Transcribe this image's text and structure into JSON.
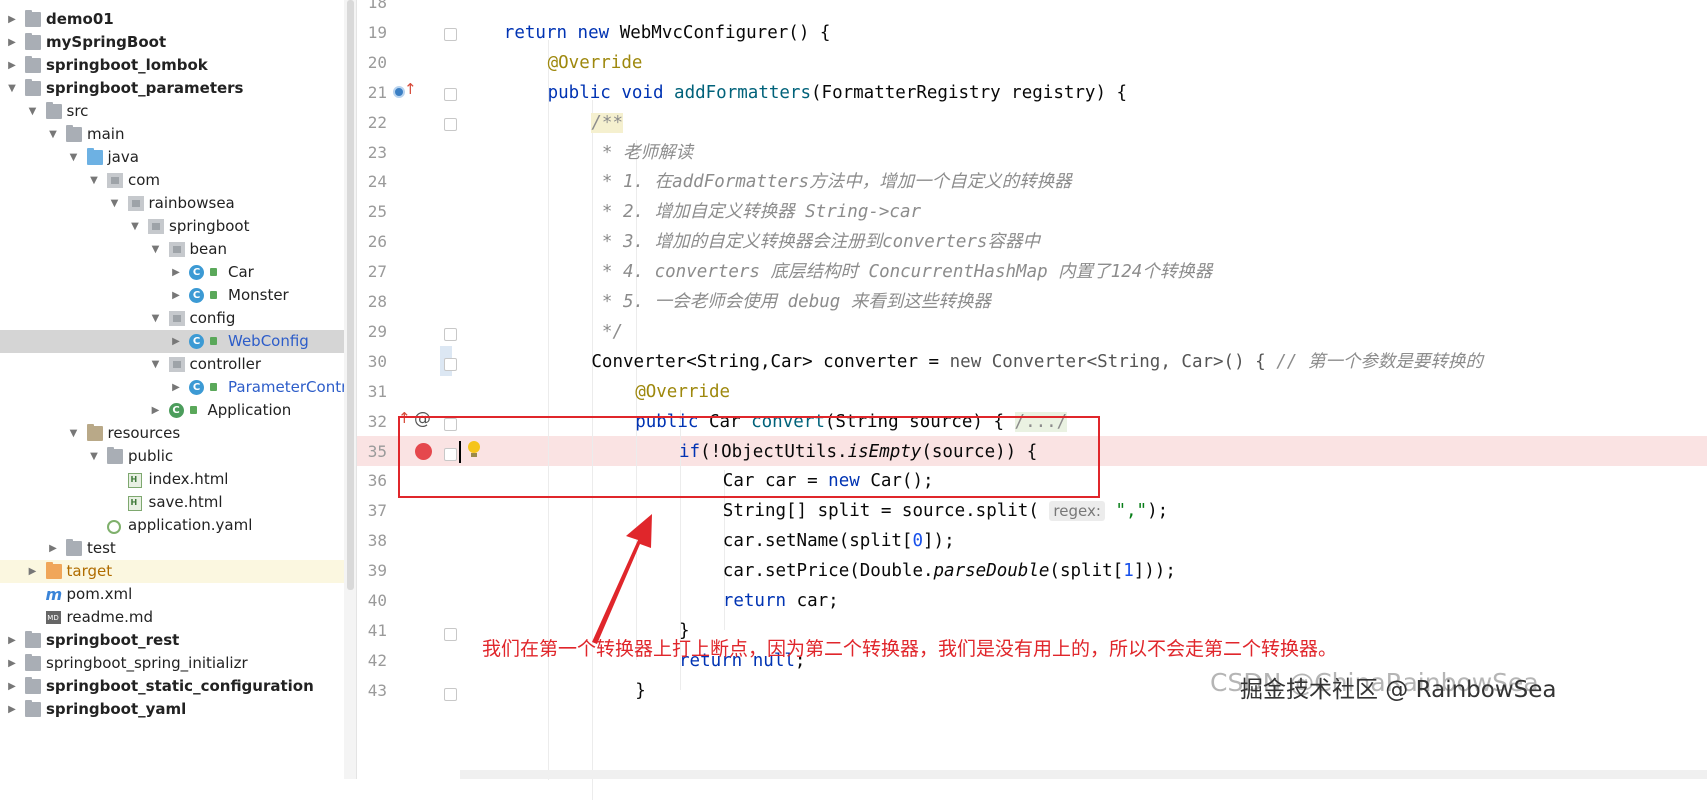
{
  "project_tree": [
    {
      "label": "demo01",
      "indent": 0,
      "arrow": "right",
      "icon": "folder",
      "bold": true
    },
    {
      "label": "mySpringBoot",
      "indent": 0,
      "arrow": "right",
      "icon": "folder",
      "bold": true
    },
    {
      "label": "springboot_lombok",
      "indent": 0,
      "arrow": "right",
      "icon": "folder",
      "bold": true
    },
    {
      "label": "springboot_parameters",
      "indent": 0,
      "arrow": "down",
      "icon": "folder",
      "bold": true
    },
    {
      "label": "src",
      "indent": 1,
      "arrow": "down",
      "icon": "folder"
    },
    {
      "label": "main",
      "indent": 2,
      "arrow": "down",
      "icon": "folder"
    },
    {
      "label": "java",
      "indent": 3,
      "arrow": "down",
      "icon": "folder-blue"
    },
    {
      "label": "com",
      "indent": 4,
      "arrow": "down",
      "icon": "package"
    },
    {
      "label": "rainbowsea",
      "indent": 5,
      "arrow": "down",
      "icon": "package"
    },
    {
      "label": "springboot",
      "indent": 6,
      "arrow": "down",
      "icon": "package"
    },
    {
      "label": "bean",
      "indent": 7,
      "arrow": "down",
      "icon": "package"
    },
    {
      "label": "Car",
      "indent": 8,
      "arrow": "right",
      "icon": "class"
    },
    {
      "label": "Monster",
      "indent": 8,
      "arrow": "right",
      "icon": "class"
    },
    {
      "label": "config",
      "indent": 7,
      "arrow": "down",
      "icon": "package"
    },
    {
      "label": "WebConfig",
      "indent": 8,
      "arrow": "right",
      "icon": "class",
      "selected": true,
      "color": "blue"
    },
    {
      "label": "controller",
      "indent": 7,
      "arrow": "down",
      "icon": "package"
    },
    {
      "label": "ParameterControlle",
      "indent": 8,
      "arrow": "right",
      "icon": "class",
      "color": "blue"
    },
    {
      "label": "Application",
      "indent": 7,
      "arrow": "right",
      "icon": "spring-class"
    },
    {
      "label": "resources",
      "indent": 3,
      "arrow": "down",
      "icon": "folder-res"
    },
    {
      "label": "public",
      "indent": 4,
      "arrow": "down",
      "icon": "folder"
    },
    {
      "label": "index.html",
      "indent": 5,
      "arrow": "none",
      "icon": "html"
    },
    {
      "label": "save.html",
      "indent": 5,
      "arrow": "none",
      "icon": "html"
    },
    {
      "label": "application.yaml",
      "indent": 4,
      "arrow": "none",
      "icon": "yaml"
    },
    {
      "label": "test",
      "indent": 2,
      "arrow": "right",
      "icon": "folder"
    },
    {
      "label": "target",
      "indent": 1,
      "arrow": "right",
      "icon": "folder-orange",
      "highlight": true,
      "color": "orange"
    },
    {
      "label": "pom.xml",
      "indent": 1,
      "arrow": "none",
      "icon": "maven"
    },
    {
      "label": "readme.md",
      "indent": 1,
      "arrow": "none",
      "icon": "markdown"
    },
    {
      "label": "springboot_rest",
      "indent": 0,
      "arrow": "right",
      "icon": "folder",
      "bold": true
    },
    {
      "label": "springboot_spring_initializr",
      "indent": 0,
      "arrow": "right",
      "icon": "folder"
    },
    {
      "label": "springboot_static_configuration",
      "indent": 0,
      "arrow": "right",
      "icon": "folder",
      "bold": true
    },
    {
      "label": "springboot_yaml",
      "indent": 0,
      "arrow": "right",
      "icon": "folder",
      "bold": true
    }
  ],
  "editor": {
    "lines": [
      {
        "n": "18",
        "parts": []
      },
      {
        "n": "19",
        "indent": 4,
        "parts": [
          [
            "kw",
            "return new "
          ],
          [
            "",
            "WebMvcConfigurer() {"
          ]
        ]
      },
      {
        "n": "20",
        "indent": 8,
        "parts": [
          [
            "ann",
            "@Override"
          ]
        ]
      },
      {
        "n": "21",
        "indent": 8,
        "parts": [
          [
            "kw",
            "public void "
          ],
          [
            "fn",
            "addFormatters"
          ],
          [
            "",
            "(FormatterRegistry registry) {"
          ]
        ]
      },
      {
        "n": "22",
        "indent": 12,
        "parts": [
          [
            "cm docbg",
            "/**"
          ]
        ]
      },
      {
        "n": "23",
        "indent": 12,
        "parts": [
          [
            "cm",
            " * 老师解读"
          ]
        ]
      },
      {
        "n": "24",
        "indent": 12,
        "parts": [
          [
            "cm",
            " * 1. 在addFormatters方法中，增加一个自定义的转换器"
          ]
        ]
      },
      {
        "n": "25",
        "indent": 12,
        "parts": [
          [
            "cm",
            " * 2. 增加自定义转换器 String->car"
          ]
        ]
      },
      {
        "n": "26",
        "indent": 12,
        "parts": [
          [
            "cm",
            " * 3. 增加的自定义转换器会注册到converters容器中"
          ]
        ]
      },
      {
        "n": "27",
        "indent": 12,
        "parts": [
          [
            "cm",
            " * 4. converters 底层结构时 ConcurrentHashMap 内置了124个转换器"
          ]
        ]
      },
      {
        "n": "28",
        "indent": 12,
        "parts": [
          [
            "cm",
            " * 5. 一会老师会使用 debug 来看到这些转换器"
          ]
        ]
      },
      {
        "n": "29",
        "indent": 12,
        "parts": [
          [
            "cm",
            " */"
          ]
        ]
      },
      {
        "n": "30",
        "indent": 12,
        "parts": [
          [
            "",
            "Converter<String,Car> converter = "
          ],
          [
            "gry",
            "new Converter<String, Car>() { "
          ],
          [
            "cm",
            "// 第一个参数是要转换的"
          ]
        ]
      },
      {
        "n": "31",
        "indent": 16,
        "parts": [
          [
            "ann",
            "@Override"
          ]
        ]
      },
      {
        "n": "32",
        "indent": 16,
        "parts": [
          [
            "kw",
            "public "
          ],
          [
            "",
            "Car "
          ],
          [
            "fn",
            "convert"
          ],
          [
            "",
            "(String source) { "
          ],
          [
            "foldtxt",
            "/.../"
          ]
        ]
      },
      {
        "n": "35",
        "indent": 20,
        "parts": [
          [
            "kw",
            "if"
          ],
          [
            "",
            "(!ObjectUtils."
          ],
          [
            "it",
            "isEmpty"
          ],
          [
            "",
            "(source)) {"
          ]
        ]
      },
      {
        "n": "36",
        "indent": 24,
        "parts": [
          [
            "",
            "Car car = "
          ],
          [
            "kw",
            "new "
          ],
          [
            "",
            "Car();"
          ]
        ]
      },
      {
        "n": "37",
        "indent": 24,
        "parts": [
          [
            "",
            "String[] split = source.split( "
          ],
          [
            "hint",
            "regex:"
          ],
          [
            "str",
            " \",\""
          ],
          [
            "",
            ");"
          ]
        ]
      },
      {
        "n": "38",
        "indent": 24,
        "parts": [
          [
            "",
            "car.setName(split["
          ],
          [
            "num",
            "0"
          ],
          [
            "",
            "]);"
          ]
        ]
      },
      {
        "n": "39",
        "indent": 24,
        "parts": [
          [
            "",
            "car.setPrice(Double."
          ],
          [
            "it",
            "parseDouble"
          ],
          [
            "",
            "(split["
          ],
          [
            "num",
            "1"
          ],
          [
            "",
            "]));"
          ]
        ]
      },
      {
        "n": "40",
        "indent": 24,
        "parts": [
          [
            "kw",
            "return "
          ],
          [
            "",
            "car;"
          ]
        ]
      },
      {
        "n": "41",
        "indent": 20,
        "parts": [
          [
            "",
            "}"
          ]
        ]
      },
      {
        "n": "42",
        "indent": 20,
        "parts": [
          [
            "kw",
            "return "
          ],
          [
            "kw",
            "null"
          ],
          [
            "",
            ";"
          ]
        ]
      },
      {
        "n": "43",
        "indent": 16,
        "parts": [
          [
            "",
            "}"
          ]
        ]
      }
    ]
  },
  "annotation_text": "我们在第一个转换器上打上断点，因为第二个转换器，我们是没有用上的，所以不会走第二个转换器。",
  "watermark": "CSDN @ChinaRainbowSea",
  "watermark2": "掘金技术社区 @ RainbowSea",
  "colors": {
    "breakpoint": "#e5484d",
    "annotation": "#e0262b",
    "selection": "#d5d5d5"
  }
}
